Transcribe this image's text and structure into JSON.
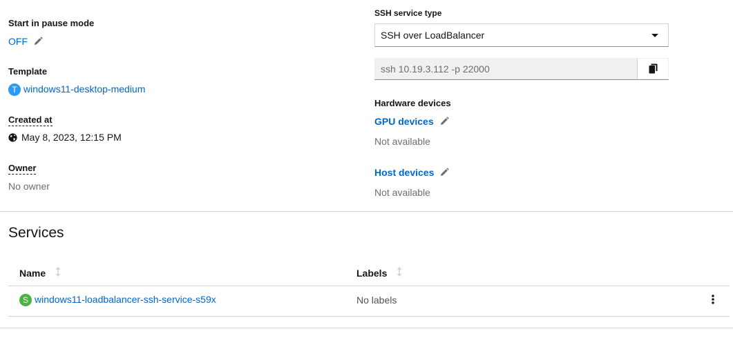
{
  "details": {
    "pause": {
      "label": "Start in pause mode",
      "value": "OFF"
    },
    "template": {
      "label": "Template",
      "badge": "T",
      "value": "windows11-desktop-medium",
      "badge_color": "#2b9af3"
    },
    "created": {
      "label": "Created at",
      "value": "May 8, 2023, 12:15 PM"
    },
    "owner": {
      "label": "Owner",
      "value": "No owner"
    },
    "ssh_type": {
      "label": "SSH service type",
      "selected": "SSH over LoadBalancer"
    },
    "ssh_command": {
      "value": "ssh 10.19.3.112 -p 22000"
    },
    "hardware": {
      "label": "Hardware devices",
      "gpu": {
        "label": "GPU devices",
        "value": "Not available"
      },
      "host": {
        "label": "Host devices",
        "value": "Not available"
      }
    }
  },
  "services": {
    "title": "Services",
    "columns": {
      "name": "Name",
      "labels": "Labels"
    },
    "rows": [
      {
        "badge": "S",
        "name": "windows11-loadbalancer-ssh-service-s59x",
        "labels": "No labels",
        "badge_color": "#4cb140"
      }
    ]
  },
  "colors": {
    "link": "#0066cc",
    "muted": "#6a6e73",
    "border": "#d2d2d2"
  },
  "icons": [
    "pencil-icon",
    "globe-icon",
    "caret-down-icon",
    "copy-icon",
    "sort-icon",
    "kebab-icon"
  ]
}
